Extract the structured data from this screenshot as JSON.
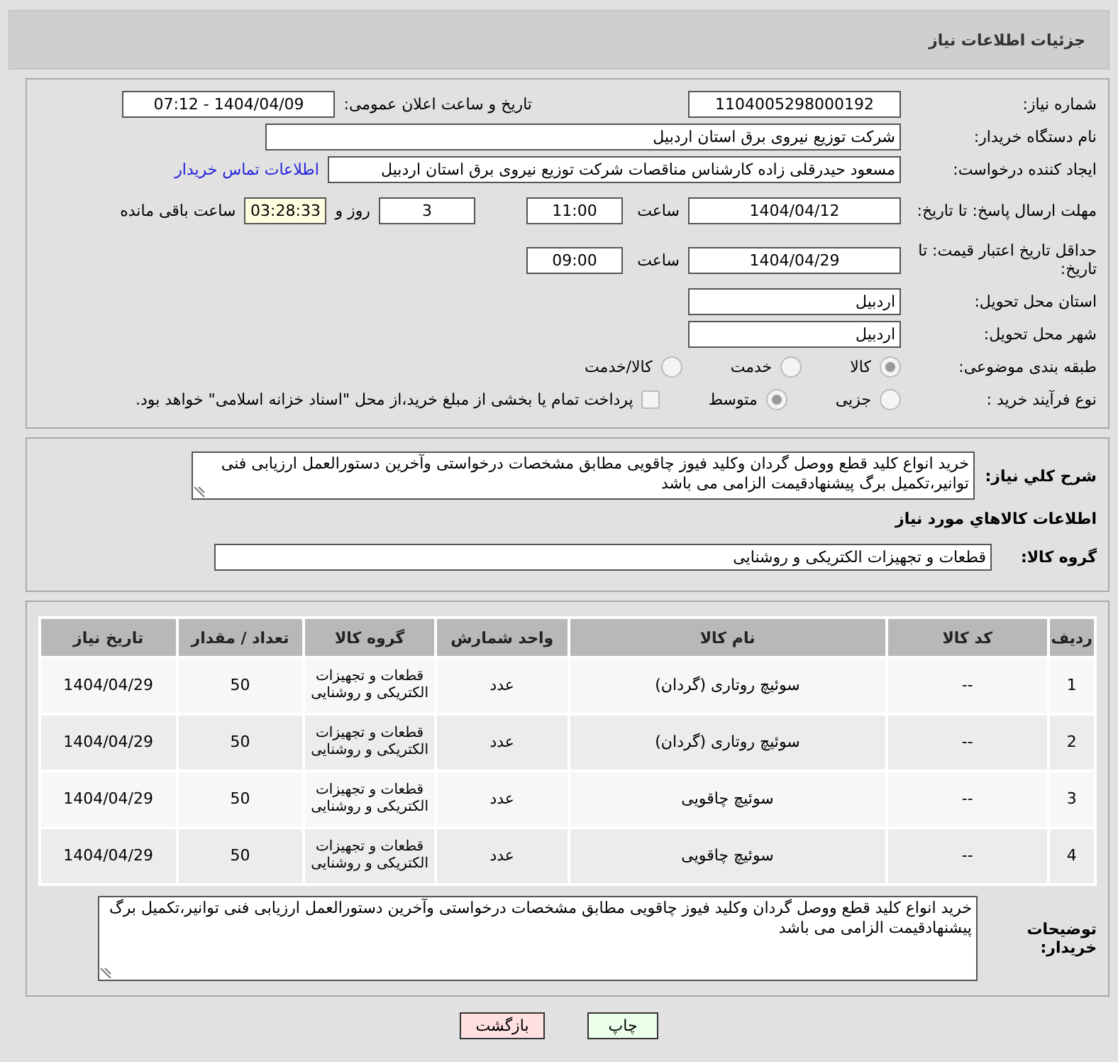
{
  "page_title": "جزئیات اطلاعات نیاز",
  "form": {
    "need_number": {
      "label": "شماره نیاز:",
      "value": "1104005298000192"
    },
    "announce": {
      "label": "تاریخ و ساعت اعلان عمومی:",
      "value": "1404/04/09 - 07:12"
    },
    "buyer_org": {
      "label": "نام دستگاه خریدار:",
      "value": "شرکت توزیع نیروی برق استان اردبیل"
    },
    "requester": {
      "label": "ایجاد کننده درخواست:",
      "value": "مسعود حیدرقلی زاده کارشناس مناقصات شرکت توزیع نیروی برق استان اردبیل",
      "link": "اطلاعات تماس خریدار"
    },
    "deadline": {
      "label": "مهلت ارسال پاسخ: تا تاریخ:",
      "date": "1404/04/12",
      "time_label": "ساعت",
      "time": "11:00",
      "days": "3",
      "days_label": "روز و",
      "remaining": "03:28:33",
      "remaining_label": "ساعت باقی مانده"
    },
    "validity": {
      "label": "حداقل تاریخ اعتبار قیمت: تا تاریخ:",
      "date": "1404/04/29",
      "time_label": "ساعت",
      "time": "09:00"
    },
    "province": {
      "label": "استان محل تحویل:",
      "value": "اردبیل"
    },
    "city": {
      "label": "شهر محل تحویل:",
      "value": "اردبیل"
    },
    "category": {
      "label": "طبقه بندی موضوعی:",
      "options": [
        {
          "label": "کالا",
          "selected": true
        },
        {
          "label": "خدمت",
          "selected": false
        },
        {
          "label": "کالا/خدمت",
          "selected": false
        }
      ]
    },
    "purchase_type": {
      "label": "نوع فرآیند خرید :",
      "options": [
        {
          "label": "جزیی",
          "selected": false
        },
        {
          "label": "متوسط",
          "selected": true
        }
      ],
      "payment": {
        "label": "پرداخت تمام یا بخشی از مبلغ خرید،از محل \"اسناد خزانه اسلامی\" خواهد بود.",
        "checked": false
      }
    }
  },
  "description": {
    "label": "شرح کلي نياز:",
    "value": "خرید انواع کلید قطع ووصل گردان وکلید فیوز چاقویی مطابق مشخصات درخواستی وآخرین دستورالعمل ارزیابی فنی توانیر،تکمیل برگ پیشنهادقیمت الزامی می باشد"
  },
  "items_title": "اطلاعات کالاهاي مورد نياز",
  "goods_group": {
    "label": "گروه کالا:",
    "value": "قطعات و تجهیزات الکتریکی و روشنایی"
  },
  "table": {
    "columns": [
      "ردیف",
      "کد کالا",
      "نام کالا",
      "واحد شمارش",
      "گروه کالا",
      "تعداد / مقدار",
      "تاریخ نیاز"
    ],
    "rows": [
      [
        "1",
        "--",
        "سوئیچ روتاری (گردان)",
        "عدد",
        "قطعات و تجهیزات الکتریکی و روشنایی",
        "50",
        "1404/04/29"
      ],
      [
        "2",
        "--",
        "سوئیچ روتاری (گردان)",
        "عدد",
        "قطعات و تجهیزات الکتریکی و روشنایی",
        "50",
        "1404/04/29"
      ],
      [
        "3",
        "--",
        "سوئیچ چاقویی",
        "عدد",
        "قطعات و تجهیزات الکتریکی و روشنایی",
        "50",
        "1404/04/29"
      ],
      [
        "4",
        "--",
        "سوئیچ چاقویی",
        "عدد",
        "قطعات و تجهیزات الکتریکی و روشنایی",
        "50",
        "1404/04/29"
      ]
    ]
  },
  "buyer_notes": {
    "label": "توضیحات خریدار:",
    "value": "خرید انواع کلید قطع ووصل گردان وکلید فیوز چاقویی مطابق مشخصات درخواستی وآخرین دستورالعمل ارزیابی فنی توانیر،تکمیل برگ پیشنهادقیمت الزامی می باشد"
  },
  "buttons": [
    {
      "label": "چاپ",
      "kind": "print"
    },
    {
      "label": "بازگشت",
      "kind": "back"
    }
  ]
}
